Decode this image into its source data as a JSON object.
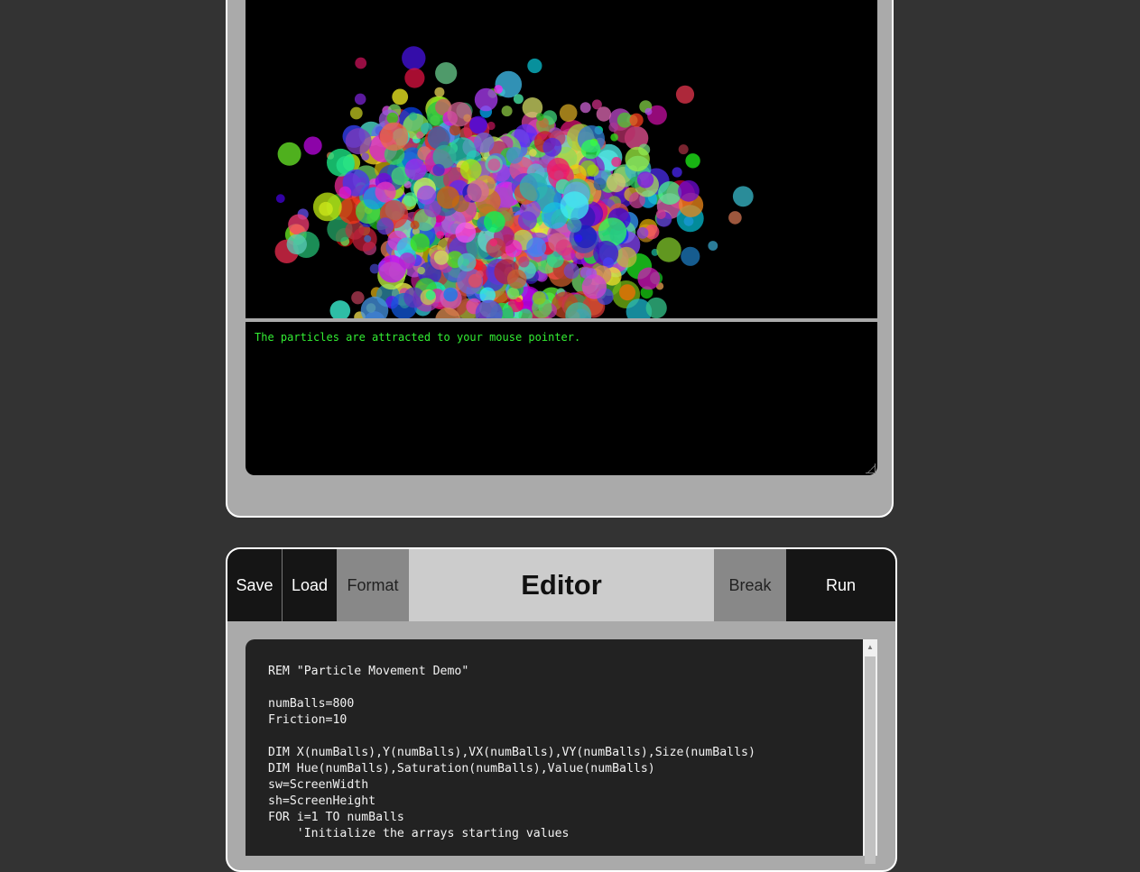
{
  "output": {
    "console_text": "The particles are attracted to your mouse pointer.",
    "canvas_background": "#000000",
    "console_text_color": "#33ee33"
  },
  "toolbar": {
    "save_label": "Save",
    "load_label": "Load",
    "format_label": "Format",
    "title": "Editor",
    "break_label": "Break",
    "run_label": "Run"
  },
  "editor": {
    "code": "REM \"Particle Movement Demo\"\n\nnumBalls=800\nFriction=10\n\nDIM X(numBalls),Y(numBalls),VX(numBalls),VY(numBalls),Size(numBalls)\nDIM Hue(numBalls),Saturation(numBalls),Value(numBalls)\nsw=ScreenWidth\nsh=ScreenHeight\nFOR i=1 TO numBalls\n    'Initialize the arrays starting values"
  },
  "icons": {
    "scroll_up": "scroll-up-arrow-icon"
  }
}
